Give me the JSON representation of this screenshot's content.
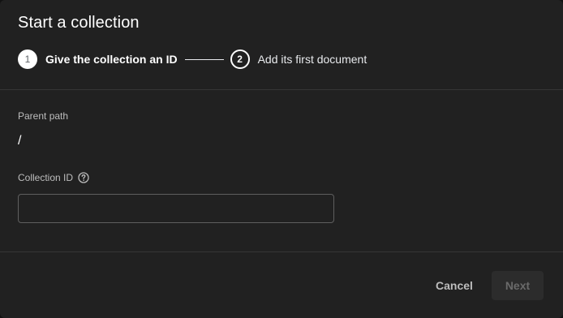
{
  "dialog": {
    "title": "Start a collection"
  },
  "stepper": {
    "steps": [
      {
        "number": "1",
        "label": "Give the collection an ID",
        "state": "active"
      },
      {
        "number": "2",
        "label": "Add its first document",
        "state": "pending"
      }
    ]
  },
  "form": {
    "parent_path": {
      "label": "Parent path",
      "value": "/"
    },
    "collection_id": {
      "label": "Collection ID",
      "value": "",
      "help_icon": "help-circle-icon"
    }
  },
  "actions": {
    "cancel_label": "Cancel",
    "next_label": "Next",
    "next_disabled": true
  },
  "colors": {
    "dialog_background": "#212121",
    "text_primary": "#ffffff",
    "text_secondary": "#bdbdbd",
    "divider": "#363636"
  }
}
